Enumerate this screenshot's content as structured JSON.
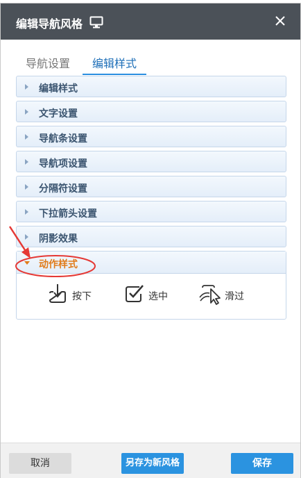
{
  "dialog": {
    "title": "编辑导航风格",
    "icon": "monitor-icon",
    "close_icon": "close-icon"
  },
  "tabs": [
    {
      "label": "导航设置",
      "active": false
    },
    {
      "label": "编辑样式",
      "active": true
    }
  ],
  "panels": [
    {
      "label": "编辑样式"
    },
    {
      "label": "文字设置"
    },
    {
      "label": "导航条设置"
    },
    {
      "label": "导航项设置"
    },
    {
      "label": "分隔符设置"
    },
    {
      "label": "下拉箭头设置"
    },
    {
      "label": "阴影效果"
    }
  ],
  "open_panel": {
    "label": "动作样式",
    "actions": [
      {
        "label": "按下",
        "icon": "press-icon"
      },
      {
        "label": "选中",
        "icon": "checkbox-icon"
      },
      {
        "label": "滑过",
        "icon": "hover-cursor-icon"
      }
    ]
  },
  "footer": {
    "cancel_label": "取消",
    "save_as_label": "另存为新风格",
    "save_label": "保存"
  },
  "colors": {
    "accent": "#2b93e0",
    "active_panel_text": "#e07b1a",
    "annotation": "#e53935",
    "titlebar": "#4b5158"
  }
}
